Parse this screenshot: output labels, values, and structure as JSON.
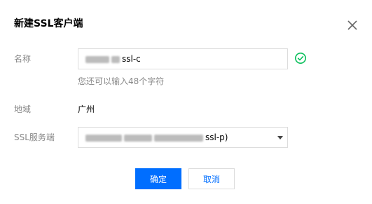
{
  "dialog": {
    "title": "新建SSL客户端"
  },
  "form": {
    "name_label": "名称",
    "name_value_suffix": "ssl-c",
    "name_hint": "您还可以输入48个字符",
    "region_label": "地域",
    "region_value": "广州",
    "ssl_server_label": "SSL服务端",
    "ssl_server_value_suffix": "ssl-p)"
  },
  "buttons": {
    "confirm_label": "确定",
    "cancel_label": "取消"
  },
  "icons": {
    "close": "close-icon",
    "valid": "check-circle-icon",
    "dropdown": "caret-down-icon"
  },
  "colors": {
    "primary": "#006eff",
    "success": "#0abf5b",
    "label": "#888888",
    "border": "#dcdcdc"
  }
}
